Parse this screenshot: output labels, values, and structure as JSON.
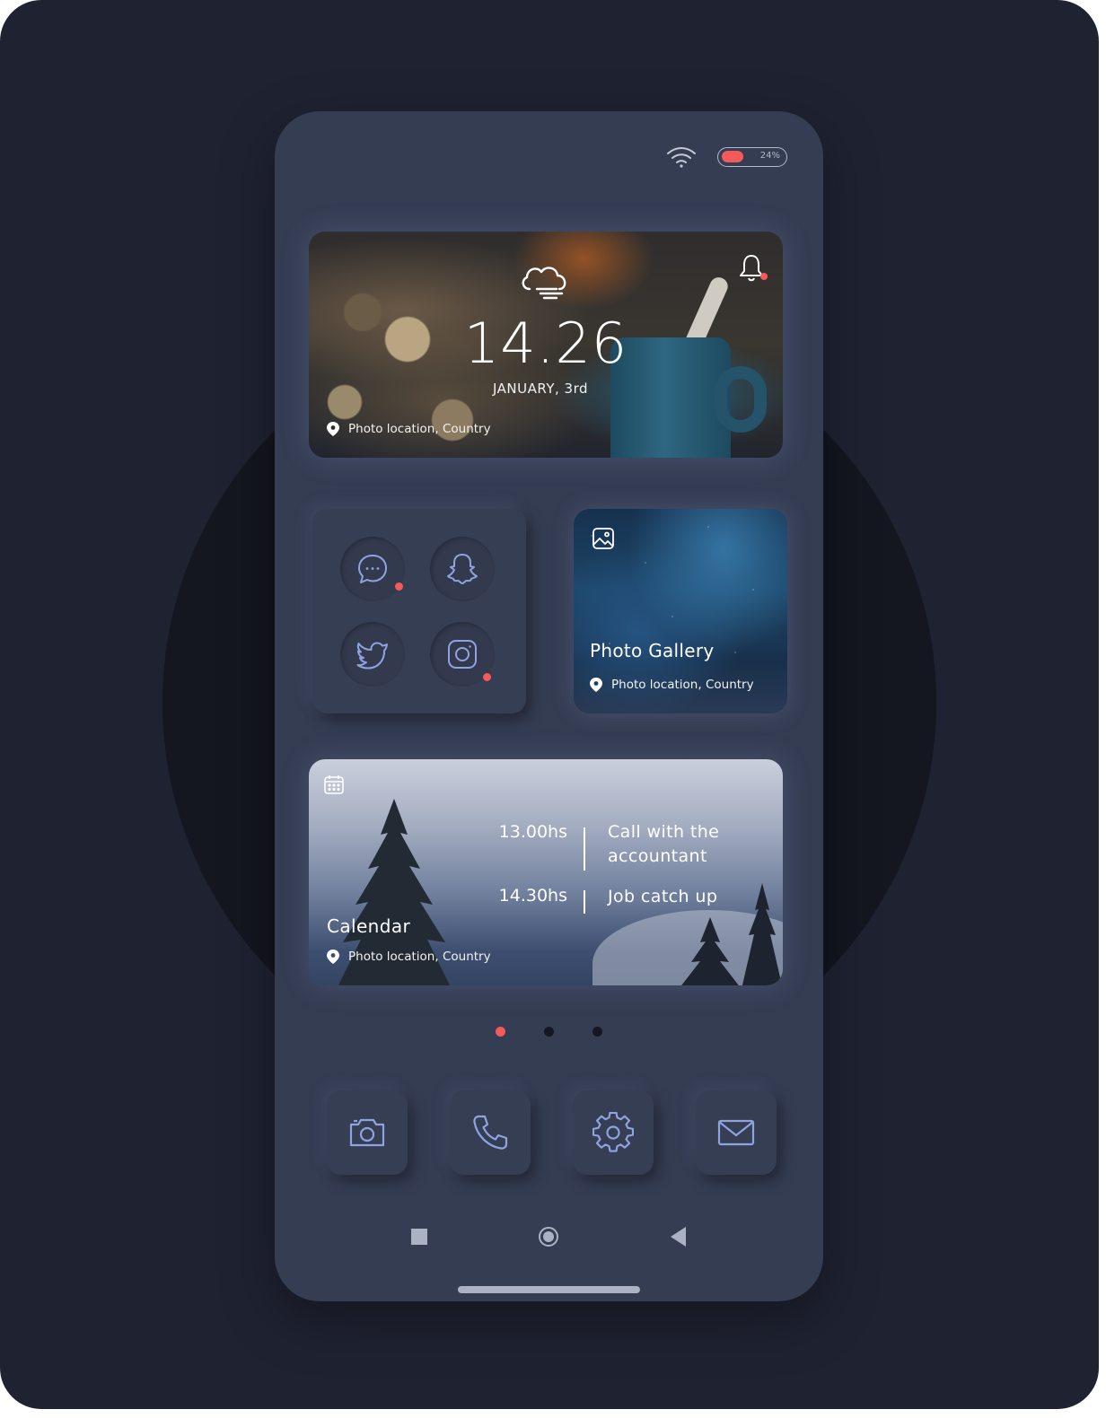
{
  "status": {
    "battery_pct": "24%",
    "battery_level": 0.24
  },
  "clock_widget": {
    "time": "14.26",
    "date": "JANUARY, 3rd",
    "location": "Photo location, Country",
    "weather_icon": "cloud-wind-icon",
    "bell_icon": "bell-icon"
  },
  "apps_widget": {
    "apps": [
      {
        "name": "messages",
        "icon": "chat-bubble-icon",
        "has_notification": true
      },
      {
        "name": "snapchat",
        "icon": "ghost-icon",
        "has_notification": false
      },
      {
        "name": "twitter",
        "icon": "bird-icon",
        "has_notification": false
      },
      {
        "name": "instagram",
        "icon": "camera-square-icon",
        "has_notification": true
      }
    ]
  },
  "gallery_widget": {
    "title": "Photo Gallery",
    "location": "Photo location, Country",
    "icon": "image-icon"
  },
  "calendar_widget": {
    "title": "Calendar",
    "location": "Photo location, Country",
    "icon": "calendar-icon",
    "events": [
      {
        "time": "13.00hs",
        "title_line1": "Call with the",
        "title_line2": "accountant"
      },
      {
        "time": "14.30hs",
        "title_line1": "Job catch up",
        "title_line2": ""
      }
    ]
  },
  "pager": {
    "pages": 3,
    "active": 0
  },
  "dock": [
    {
      "name": "camera",
      "icon": "camera-icon"
    },
    {
      "name": "phone",
      "icon": "phone-icon"
    },
    {
      "name": "settings",
      "icon": "gear-icon"
    },
    {
      "name": "mail",
      "icon": "envelope-icon"
    }
  ],
  "colors": {
    "accent": "#f35a5a",
    "phone_bg": "#353d53",
    "icon_stroke": "#8fa3e0",
    "page_bg": "#1f2231"
  }
}
